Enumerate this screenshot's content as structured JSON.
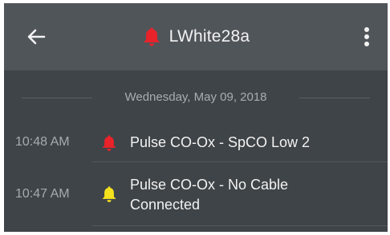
{
  "header": {
    "title": "LWhite28a",
    "back_icon": "arrow-left-icon",
    "menu_icon": "more-vertical-icon",
    "title_icon": "bell-icon"
  },
  "log": {
    "date_header": "Wednesday, May 09, 2018",
    "entries": [
      {
        "time": "10:48 AM",
        "icon": "bell-icon",
        "severity": "high",
        "color": "#e8232a",
        "message": "Pulse CO-Ox - SpCO Low 2"
      },
      {
        "time": "10:47 AM",
        "icon": "bell-icon",
        "severity": "medium",
        "color": "#f4e21e",
        "message_line1": "Pulse CO-Ox - No Cable",
        "message_line2": "Connected"
      }
    ]
  },
  "colors": {
    "header_bg": "#50555a",
    "body_bg": "#3f4448",
    "alarm_high": "#e8232a",
    "alarm_medium": "#f4e21e"
  }
}
